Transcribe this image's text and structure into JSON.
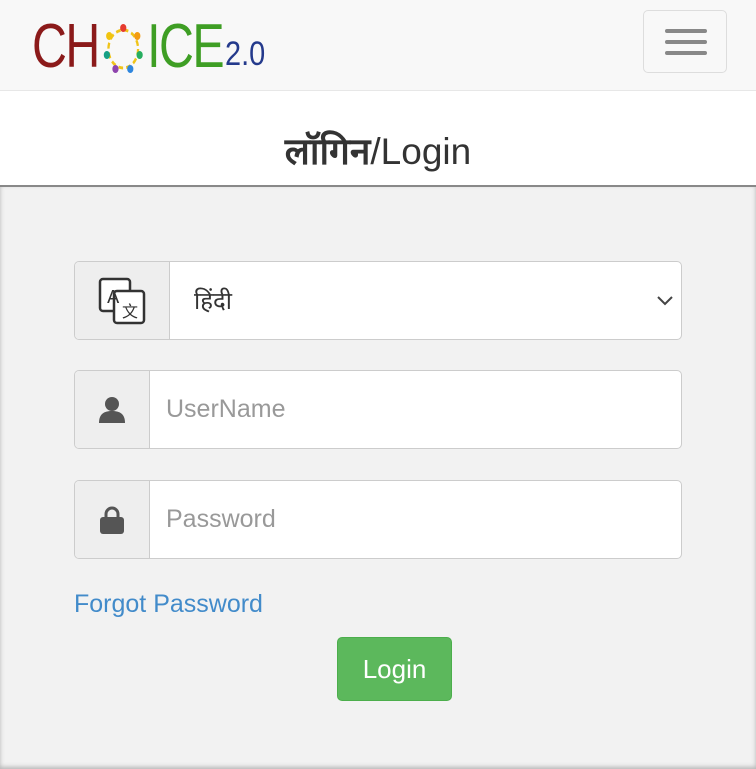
{
  "header": {
    "logo": {
      "part1": "CH",
      "part2": "ICE",
      "version": "2.0"
    },
    "menu_icon": "hamburger-menu-icon"
  },
  "title": {
    "hindi": "लॉगिन",
    "sep_english": "/Login"
  },
  "form": {
    "language": {
      "icon": "translate-icon",
      "selected": "हिंदी",
      "chevron": "chevron-down-icon"
    },
    "username": {
      "icon": "user-icon",
      "placeholder": "UserName"
    },
    "password": {
      "icon": "lock-icon",
      "placeholder": "Password"
    },
    "forgot_link": "Forgot Password",
    "login_label": "Login"
  },
  "colors": {
    "login_button": "#5cb85c",
    "link": "#428bca",
    "logo_ch": "#8b1a1a",
    "logo_ice": "#3e9e24",
    "logo_version": "#243a8c"
  }
}
